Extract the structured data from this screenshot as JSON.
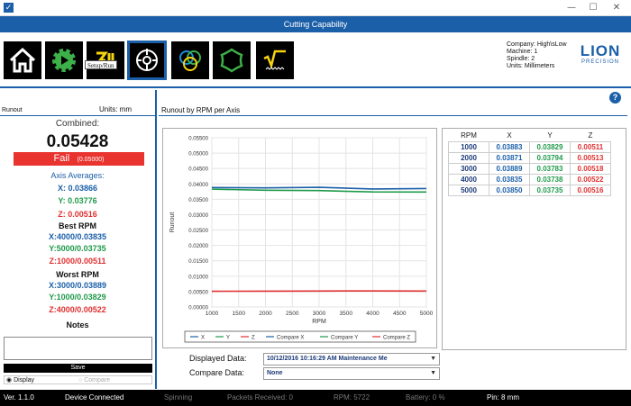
{
  "window": {
    "title": "Cutting Capability",
    "minimize": "—",
    "maximize": "☐",
    "close": "✕"
  },
  "toolbar": {
    "tooltip": "Setup/Run",
    "company": [
      "Company: High\\sLow",
      "Machine: 1",
      "Spindle: 2",
      "Units: Millimeters"
    ],
    "logo_big": "LION",
    "logo_small": "PRECISION"
  },
  "left": {
    "section_title": "Runout",
    "units": "Units: mm",
    "combined_label": "Combined:",
    "combined_value": "0.05428",
    "fail_label": "Fail",
    "fail_limit": "(0.05000)",
    "axis_avg_label": "Axis Averages:",
    "avg_x": "X:  0.03866",
    "avg_y": "Y:  0.03776",
    "avg_z": "Z:  0.00516",
    "best_label": "Best RPM",
    "best_x": "X:4000/0.03835",
    "best_y": "Y:5000/0.03735",
    "best_z": "Z:1000/0.00511",
    "worst_label": "Worst RPM",
    "worst_x": "X:3000/0.03889",
    "worst_y": "Y:1000/0.03829",
    "worst_z": "Z:4000/0.00522",
    "notes_label": "Notes",
    "save_label": "Save",
    "display_label": "Display",
    "compare_label": "Compare"
  },
  "main": {
    "section_title": "Runout by RPM per Axis",
    "help": "?",
    "displayed_label": "Displayed Data:",
    "displayed_value": "10/12/2016 10:16:29 AM Maintenance Me",
    "compare_label": "Compare Data:",
    "compare_value": "None",
    "table_headers": [
      "RPM",
      "X",
      "Y",
      "Z"
    ],
    "table_rows": [
      [
        "1000",
        "0.03883",
        "0.03829",
        "0.00511"
      ],
      [
        "2000",
        "0.03871",
        "0.03794",
        "0.00513"
      ],
      [
        "3000",
        "0.03889",
        "0.03783",
        "0.00518"
      ],
      [
        "4000",
        "0.03835",
        "0.03738",
        "0.00522"
      ],
      [
        "5000",
        "0.03850",
        "0.03735",
        "0.00516"
      ]
    ]
  },
  "colors": {
    "x": "#1b5fa8",
    "y": "#1f9a4a",
    "z": "#e03030",
    "accent": "#1b5fa8",
    "fail": "#e8332e"
  },
  "chart_data": {
    "type": "line",
    "xlabel": "RPM",
    "ylabel": "Runout",
    "xlim": [
      1000,
      5000
    ],
    "ylim": [
      0,
      0.055
    ],
    "x_ticks": [
      "1000",
      "1500",
      "2000",
      "2500",
      "3000",
      "3500",
      "4000",
      "4500",
      "5000"
    ],
    "y_ticks": [
      "0.00000",
      "0.00500",
      "0.01000",
      "0.01500",
      "0.02000",
      "0.02500",
      "0.03000",
      "0.03500",
      "0.04000",
      "0.04500",
      "0.05000",
      "0.05500"
    ],
    "x": [
      1000,
      2000,
      3000,
      4000,
      5000
    ],
    "series": [
      {
        "name": "X",
        "values": [
          0.03883,
          0.03871,
          0.03889,
          0.03835,
          0.0385
        ]
      },
      {
        "name": "Y",
        "values": [
          0.03829,
          0.03794,
          0.03783,
          0.03738,
          0.03735
        ]
      },
      {
        "name": "Z",
        "values": [
          0.00511,
          0.00513,
          0.00518,
          0.00522,
          0.00516
        ]
      }
    ],
    "legend": [
      "X",
      "Y",
      "Z",
      "Compare X",
      "Compare Y",
      "Compare Z"
    ],
    "legend_position": "bottom",
    "grid": true
  },
  "status": {
    "version": "Ver. 1.1.0",
    "connection": "Device Connected",
    "spinning": "Spinning",
    "packets": "Packets Received:  0",
    "rpm": "RPM:   5722",
    "battery": "Battery:  0  %",
    "pin": "Pin: 8 mm"
  }
}
